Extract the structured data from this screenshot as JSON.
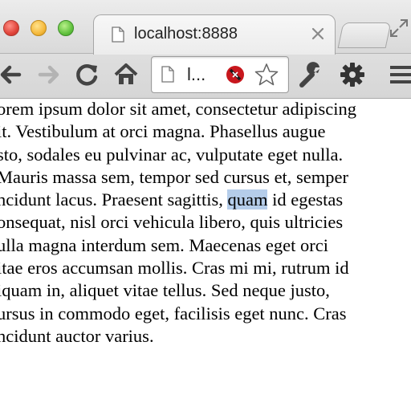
{
  "browser": {
    "tab": {
      "title": "localhost:8888",
      "page_icon": "page-icon",
      "close_icon": "close-icon"
    },
    "omnibox": {
      "text": "l...",
      "page_icon": "page-icon",
      "blocked_icon": "blocked-content-icon",
      "bookmark_icon": "star-icon"
    },
    "toolbar": [
      "back-arrow-icon",
      "forward-arrow-icon",
      "reload-icon",
      "home-icon",
      "wrench-icon",
      "gear-icon",
      "menu-icon"
    ]
  },
  "content": {
    "lines": [
      {
        "before": "orem ipsum dolor sit amet, consectetur adipiscing",
        "selected": "",
        "after": ""
      },
      {
        "before": "it. Vestibulum at orci magna. Phasellus augue",
        "selected": "",
        "after": ""
      },
      {
        "before": "sto, sodales eu pulvinar ac, vulputate eget nulla.",
        "selected": "",
        "after": ""
      },
      {
        "before": "Mauris massa sem, tempor sed cursus et, semper",
        "selected": "",
        "after": ""
      },
      {
        "before": "ncidunt lacus. Praesent sagittis, ",
        "selected": "quam",
        "after": " id egestas"
      },
      {
        "before": "onsequat, nisl orci vehicula libero, quis ultricies",
        "selected": "",
        "after": ""
      },
      {
        "before": "ulla magna interdum sem. Maecenas eget orci",
        "selected": "",
        "after": ""
      },
      {
        "before": "itae eros accumsan mollis. Cras mi mi, rutrum id",
        "selected": "",
        "after": ""
      },
      {
        "before": "iquam in, aliquet vitae tellus. Sed neque justo,",
        "selected": "",
        "after": ""
      },
      {
        "before": "ursus in commodo eget, facilisis eget nunc. Cras",
        "selected": "",
        "after": ""
      },
      {
        "before": "ncidunt auctor varius.",
        "selected": "",
        "after": ""
      }
    ]
  },
  "colors": {
    "selection": "#b5cdea",
    "toolbar_icon": "#444444"
  }
}
